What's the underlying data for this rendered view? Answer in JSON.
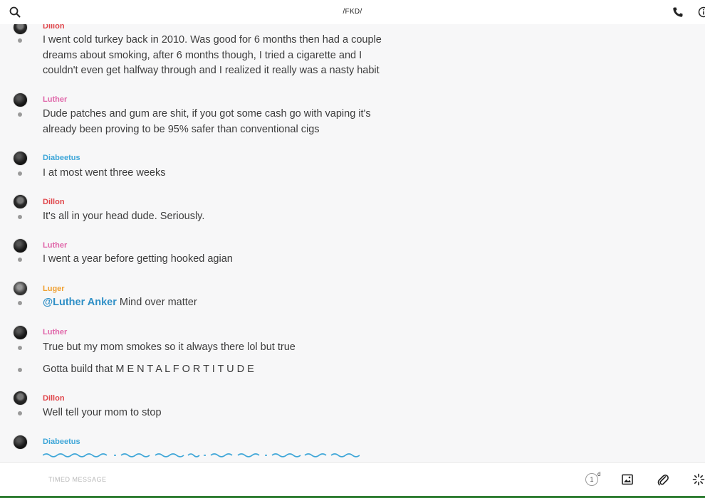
{
  "header": {
    "title": "/FKD/",
    "search_icon": "search-icon",
    "call_icon": "phone-icon",
    "info_icon": "info-icon"
  },
  "messages": [
    {
      "author": "Dillon",
      "text": "I went cold turkey back in 2010. Was good for 6 months then had a couple dreams about smoking, after 6 months though, I tried a cigarette and I couldn't even get halfway through and I realized it really was a nasty habit"
    },
    {
      "author": "Luther",
      "text": "Dude patches and gum are shit, if you got some cash go with vaping it's already been proving to be 95% safer than conventional cigs"
    },
    {
      "author": "Diabeetus",
      "text": "I at most went three weeks"
    },
    {
      "author": "Dillon",
      "text": "It's all in your head dude. Seriously."
    },
    {
      "author": "Luther",
      "text": "I went a year before getting hooked agian"
    },
    {
      "author": "Luger",
      "mention": "@Luther Anker",
      "text": " Mind over matter"
    },
    {
      "author": "Luther",
      "text": "True but my mom smokes so it always there lol but true"
    },
    {
      "author": "",
      "text": "Gotta build that M E N T A L   F O R T I T U D E"
    },
    {
      "author": "Dillon",
      "text": "Well tell your mom to stop"
    },
    {
      "author": "Diabeetus",
      "text": ""
    }
  ],
  "composer": {
    "placeholder": "TIMED MESSAGE",
    "timer_value": "1",
    "timer_unit": "d"
  },
  "colors": {
    "dillon": "#e0474c",
    "luther": "#e066a9",
    "diabeetus": "#3ea6d8",
    "luger": "#f0a030",
    "mention": "#2f8fc6"
  }
}
